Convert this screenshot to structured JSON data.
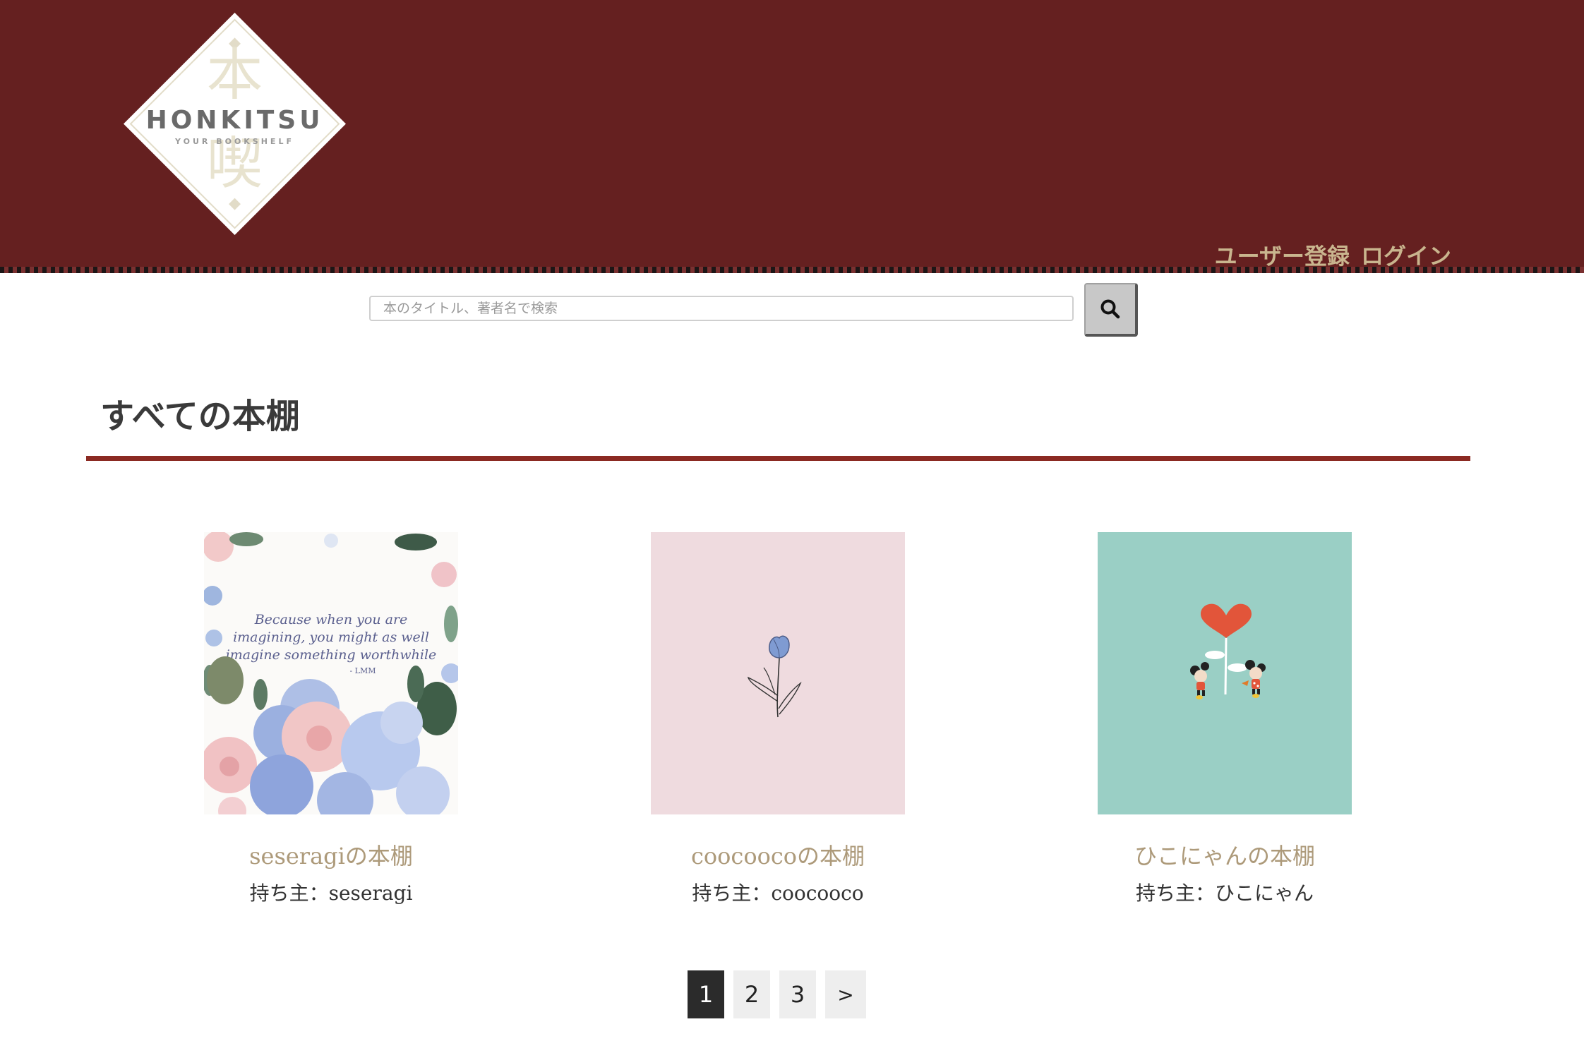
{
  "header": {
    "logo": {
      "kanji_top": "本",
      "kanji_bottom": "喫",
      "name": "HONKITSU",
      "tagline": "YOUR BOOKSHELF"
    },
    "nav": {
      "register": "ユーザー登録",
      "login": "ログイン"
    }
  },
  "search": {
    "placeholder": "本のタイトル、著者名で検索",
    "icon": "search-icon"
  },
  "main": {
    "title": "すべての本棚",
    "shelves": [
      {
        "name": "seseragiの本棚",
        "owner": "持ち主：seseragi",
        "cover_quote": [
          "Because when you are",
          "imagining, you might as well",
          "imagine something worthwhile",
          "- LMM"
        ]
      },
      {
        "name": "coocoocoの本棚",
        "owner": "持ち主：coocooco"
      },
      {
        "name": "ひこにゃんの本棚",
        "owner": "持ち主：ひこにゃん"
      }
    ]
  },
  "pagination": {
    "pages": [
      "1",
      "2",
      "3"
    ],
    "next": ">",
    "current": "1"
  },
  "colors": {
    "header_bg": "#652020",
    "accent_rule": "#8b2a22",
    "nav_text": "#c9b58e",
    "shelf_name": "#ad9a7a",
    "cover_pink": "#efdbdf",
    "cover_teal": "#9acfc5",
    "active_page": "#2b2b2b"
  }
}
